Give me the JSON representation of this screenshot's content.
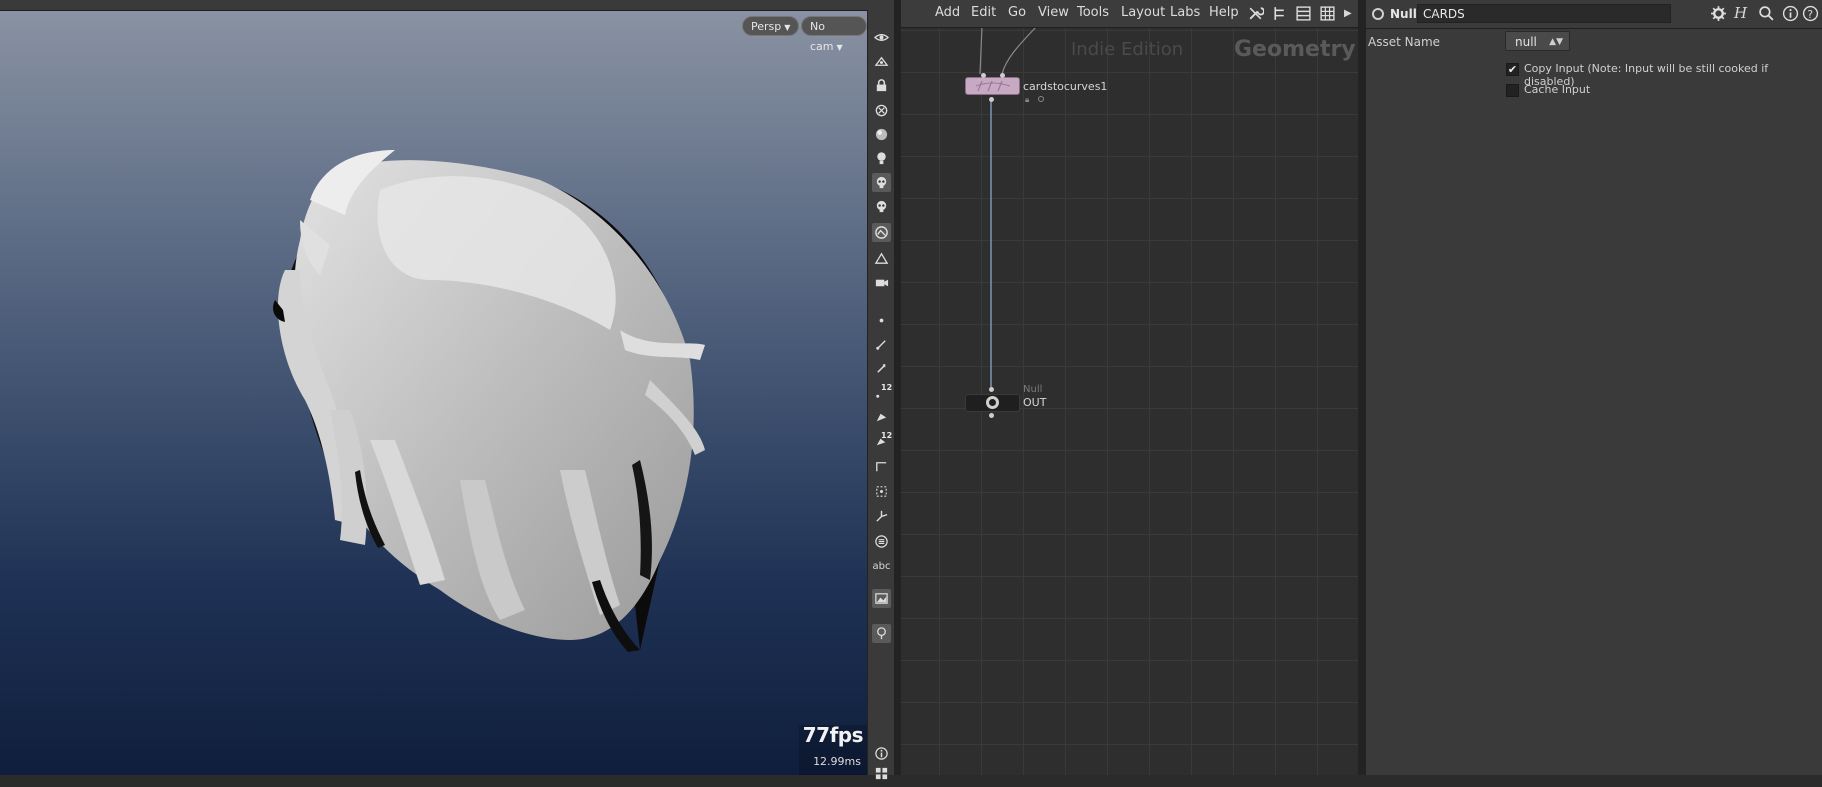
{
  "viewport": {
    "camera_mode": "Persp",
    "camera_select": "No cam",
    "fps": "77fps",
    "frame_time": "12.99ms"
  },
  "viewport_toolbar": {
    "text_button": "abc",
    "number_badge_1": "12",
    "number_badge_2": "12"
  },
  "network": {
    "menu": [
      "Add",
      "Edit",
      "Go",
      "View",
      "Tools",
      "Layout",
      "Labs",
      "Help"
    ],
    "watermark_edition": "Indie Edition",
    "context_label": "Geometry",
    "nodes": {
      "cards_to_curves": {
        "name": "cardstocurves1"
      },
      "out_null": {
        "type": "Null",
        "name": "OUT"
      }
    }
  },
  "params": {
    "node_type": "Null",
    "node_name": "CARDS",
    "asset_name_label": "Asset Name",
    "asset_name_value": "null",
    "copy_input_label": "Copy Input (Note: Input will be still cooked if disabled)",
    "copy_input_checked": "✔",
    "cache_input_label": "Cache Input"
  },
  "colors": {
    "node_pink": "#c8a9c4",
    "wire": "#8aa6c6",
    "bg_dark": "#2b2b2b"
  }
}
